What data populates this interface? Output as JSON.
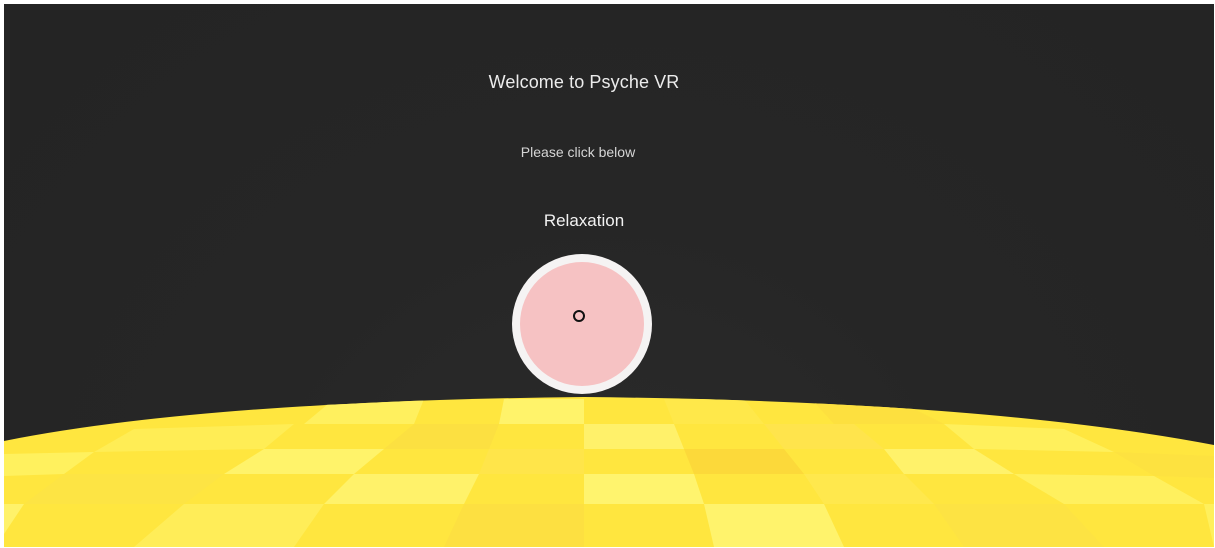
{
  "scene": {
    "title": "Welcome to Psyche VR",
    "instruction": "Please click below",
    "button_label": "Relaxation",
    "colors": {
      "background": "#262626",
      "button_ring": "#f5f3f3",
      "button_fill": "#f6c2c3",
      "floor_light": "#ffef5a",
      "floor_mid": "#ffe43c",
      "floor_dark": "#fcd93a"
    },
    "icons": {
      "reticle": "gaze-reticle-icon"
    }
  }
}
